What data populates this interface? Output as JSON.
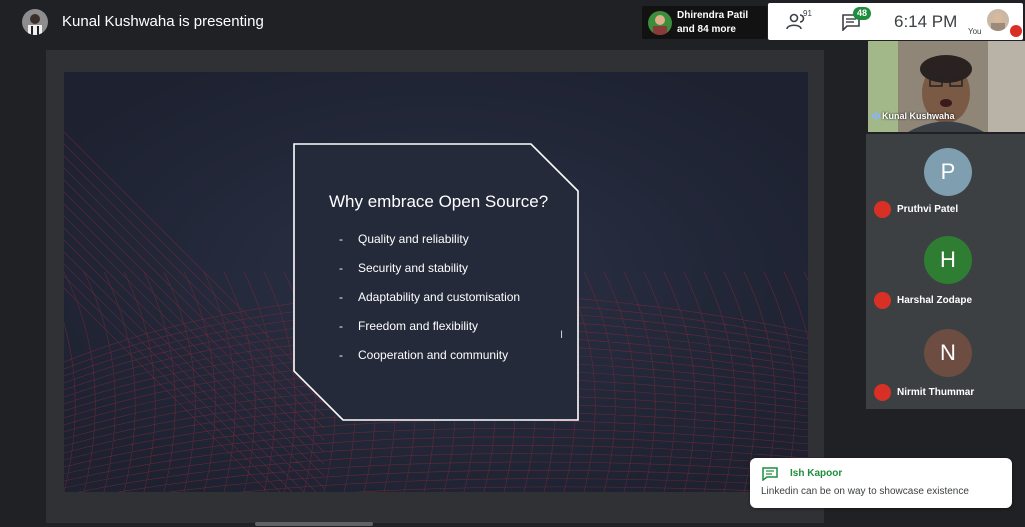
{
  "header": {
    "presenting_text": "Kunal Kushwaha is presenting",
    "participants_chip": {
      "line1": "Dhirendra Patil",
      "line2": "and 84 more"
    },
    "people_count": "91",
    "chat_badge": "48",
    "clock": "6:14 PM",
    "you_label": "You"
  },
  "slide": {
    "title": "Why embrace Open Source?",
    "bullets": [
      "Quality and reliability",
      "Security and stability",
      "Adaptability and customisation",
      "Freedom and flexibility",
      "Cooperation and community"
    ],
    "cursor_glyph": "I"
  },
  "self_tile": {
    "name": "Kunal Kushwaha"
  },
  "participants": [
    {
      "initial": "P",
      "name": "Pruthvi Patel",
      "color": "#7f9fb0"
    },
    {
      "initial": "H",
      "name": "Harshal Zodape",
      "color": "#2e7d32"
    },
    {
      "initial": "N",
      "name": "Nirmit Thummar",
      "color": "#6d4c41"
    }
  ],
  "toast": {
    "sender": "Ish Kapoor",
    "message": "Linkedin can be on way to showcase existence"
  },
  "colors": {
    "accent_green": "#1e8e3e",
    "mic_red": "#d93025"
  }
}
